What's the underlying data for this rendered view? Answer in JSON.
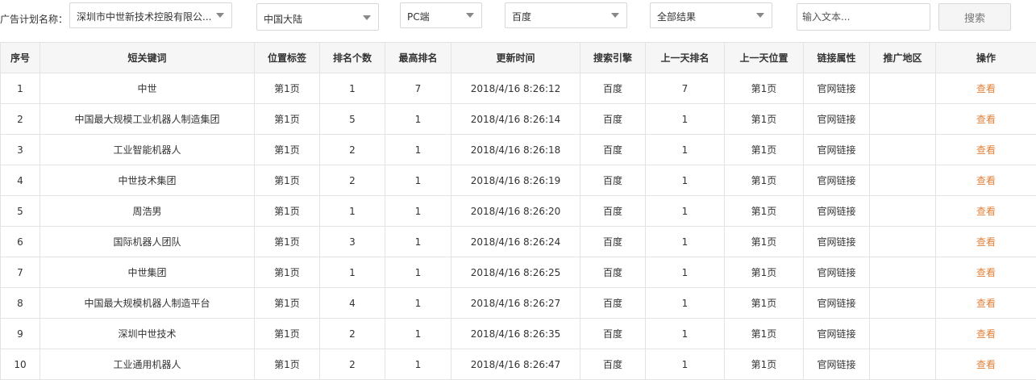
{
  "filters": {
    "plan_label": "广告计划名称：",
    "plan_value": "深圳市中世新技术控股有限公...",
    "region": "中国大陆",
    "device": "PC端",
    "engine": "百度",
    "result": "全部结果",
    "search_placeholder": "输入文本...",
    "search_button": "搜索"
  },
  "table": {
    "headers": [
      "序号",
      "短关键词",
      "位置标签",
      "排名个数",
      "最高排名",
      "更新时间",
      "搜索引擎",
      "上一天排名",
      "上一天位置",
      "链接属性",
      "推广地区",
      "操作"
    ],
    "rows": [
      [
        "1",
        "中世",
        "第1页",
        "1",
        "7",
        "2018/4/16 8:26:12",
        "百度",
        "7",
        "第1页",
        "官网链接",
        "",
        "查看"
      ],
      [
        "2",
        "中国最大规模工业机器人制造集团",
        "第1页",
        "5",
        "1",
        "2018/4/16 8:26:14",
        "百度",
        "1",
        "第1页",
        "官网链接",
        "",
        "查看"
      ],
      [
        "3",
        "工业智能机器人",
        "第1页",
        "2",
        "1",
        "2018/4/16 8:26:18",
        "百度",
        "1",
        "第1页",
        "官网链接",
        "",
        "查看"
      ],
      [
        "4",
        "中世技术集团",
        "第1页",
        "2",
        "1",
        "2018/4/16 8:26:19",
        "百度",
        "1",
        "第1页",
        "官网链接",
        "",
        "查看"
      ],
      [
        "5",
        "周浩男",
        "第1页",
        "1",
        "1",
        "2018/4/16 8:26:20",
        "百度",
        "1",
        "第1页",
        "官网链接",
        "",
        "查看"
      ],
      [
        "6",
        "国际机器人团队",
        "第1页",
        "3",
        "1",
        "2018/4/16 8:26:24",
        "百度",
        "1",
        "第1页",
        "官网链接",
        "",
        "查看"
      ],
      [
        "7",
        "中世集团",
        "第1页",
        "1",
        "1",
        "2018/4/16 8:26:25",
        "百度",
        "1",
        "第1页",
        "官网链接",
        "",
        "查看"
      ],
      [
        "8",
        "中国最大规模机器人制造平台",
        "第1页",
        "4",
        "1",
        "2018/4/16 8:26:27",
        "百度",
        "1",
        "第1页",
        "官网链接",
        "",
        "查看"
      ],
      [
        "9",
        "深圳中世技术",
        "第1页",
        "2",
        "1",
        "2018/4/16 8:26:35",
        "百度",
        "1",
        "第1页",
        "官网链接",
        "",
        "查看"
      ],
      [
        "10",
        "工业通用机器人",
        "第1页",
        "2",
        "1",
        "2018/4/16 8:26:47",
        "百度",
        "1",
        "第1页",
        "官网链接",
        "",
        "查看"
      ]
    ]
  },
  "colors": {
    "action_link": "#e0813a",
    "header_bg": "#f6f6f6",
    "border": "#e3e3e3"
  }
}
